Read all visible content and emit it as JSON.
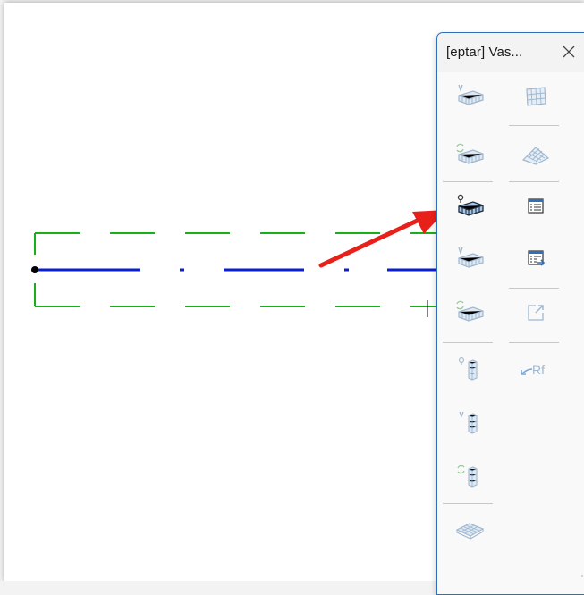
{
  "palette": {
    "title": "[eptar] Vas...",
    "close_label": "Close",
    "tools": [
      {
        "icon": "wall-select-icon",
        "state": "disabled"
      },
      {
        "icon": "grid-panel-icon",
        "state": "disabled"
      },
      {
        "icon": "wall-sync-icon",
        "state": "disabled"
      },
      {
        "icon": "roof-panel-icon",
        "state": "disabled"
      },
      {
        "icon": "wall-place-icon",
        "state": "enabled"
      },
      {
        "icon": "list-icon",
        "state": "enabled"
      },
      {
        "icon": "wall-select-alt-icon",
        "state": "disabled"
      },
      {
        "icon": "list-export-icon",
        "state": "enabled"
      },
      {
        "icon": "wall-sync-alt-icon",
        "state": "disabled"
      },
      {
        "icon": "export-icon",
        "state": "disabled"
      },
      {
        "icon": "column-place-icon",
        "state": "disabled"
      },
      {
        "icon": "refresh-rf-icon",
        "state": "disabled"
      },
      {
        "icon": "column-select-icon",
        "state": "disabled"
      },
      {
        "icon": "column-sync-icon",
        "state": "disabled"
      },
      {
        "icon": "slab-icon",
        "state": "disabled"
      }
    ],
    "rf_label": "Rf"
  },
  "colors": {
    "accent_blue": "#2f6fba",
    "line_blue": "#0a1ed2",
    "dashed_green": "#18b018",
    "arrow_red": "#e8201a",
    "disabled_icon": "#9fb7cf"
  }
}
